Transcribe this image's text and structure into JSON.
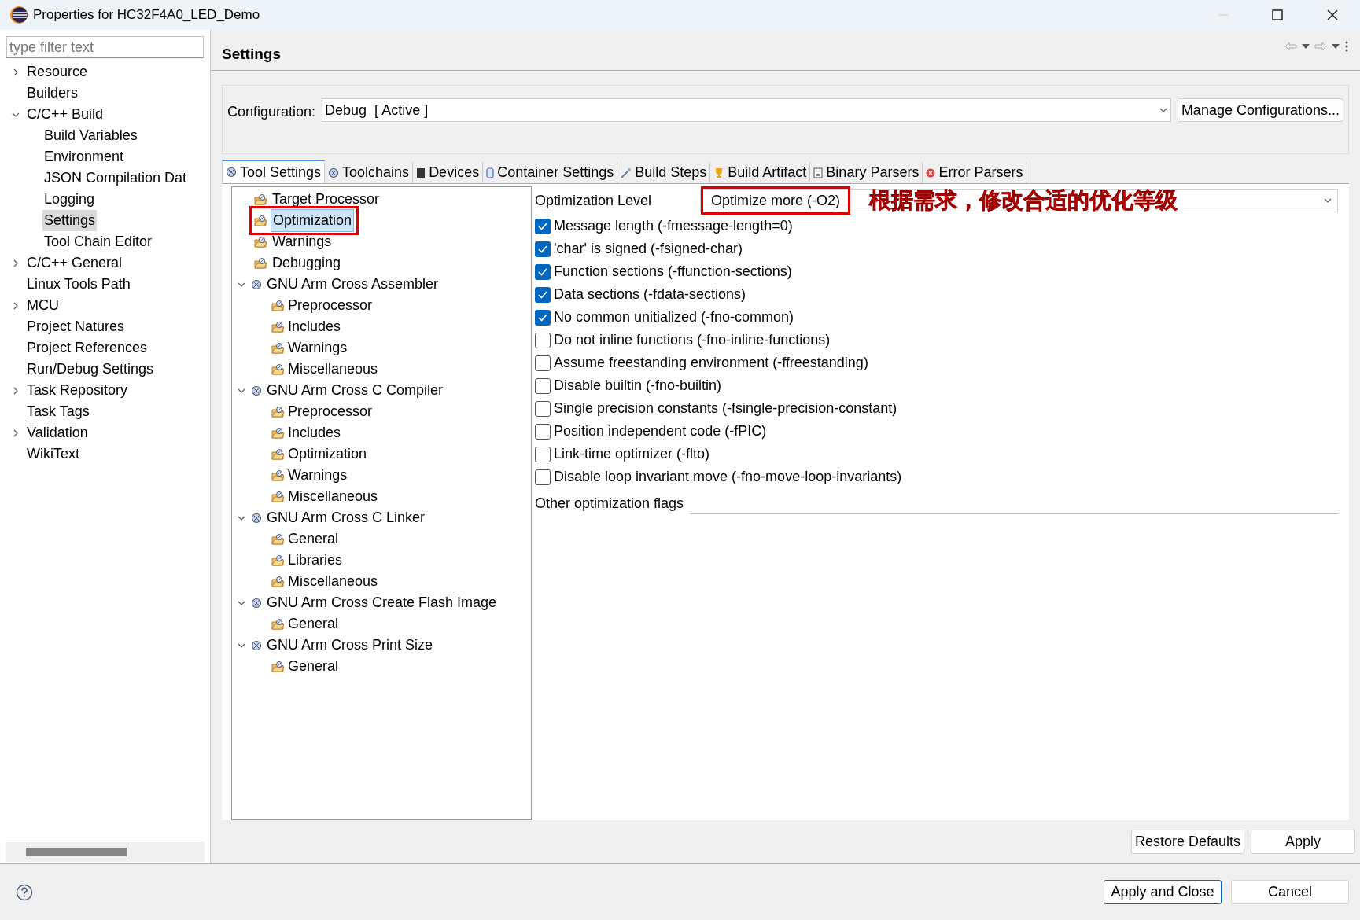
{
  "window": {
    "title": "Properties for HC32F4A0_LED_Demo"
  },
  "sidebar": {
    "filter": {
      "placeholder": "type filter text"
    },
    "items": [
      {
        "label": "Resource",
        "expanded": false,
        "selected": false
      },
      {
        "label": "Builders",
        "selected": false
      },
      {
        "label": "C/C++ Build",
        "expanded": true,
        "selected": false,
        "children": [
          {
            "label": "Build Variables",
            "selected": false
          },
          {
            "label": "Environment",
            "selected": false
          },
          {
            "label": "JSON Compilation Dat",
            "selected": false
          },
          {
            "label": "Logging",
            "selected": false
          },
          {
            "label": "Settings",
            "selected": true
          },
          {
            "label": "Tool Chain Editor",
            "selected": false
          }
        ]
      },
      {
        "label": "C/C++ General",
        "expanded": false,
        "selected": false
      },
      {
        "label": "Linux Tools Path",
        "selected": false
      },
      {
        "label": "MCU",
        "expanded": false,
        "selected": false
      },
      {
        "label": "Project Natures",
        "selected": false
      },
      {
        "label": "Project References",
        "selected": false
      },
      {
        "label": "Run/Debug Settings",
        "selected": false
      },
      {
        "label": "Task Repository",
        "expanded": false,
        "selected": false
      },
      {
        "label": "Task Tags",
        "selected": false
      },
      {
        "label": "Validation",
        "expanded": false,
        "selected": false
      },
      {
        "label": "WikiText",
        "selected": false
      }
    ]
  },
  "page": {
    "title": "Settings",
    "configuration": {
      "label": "Configuration:",
      "value": "Debug  [ Active ]",
      "button": "Manage Configurations..."
    },
    "tabs": [
      {
        "label": "Tool Settings",
        "selected": true
      },
      {
        "label": "Toolchains",
        "selected": false
      },
      {
        "label": "Devices",
        "selected": false
      },
      {
        "label": "Container Settings",
        "selected": false
      },
      {
        "label": "Build Steps",
        "selected": false
      },
      {
        "label": "Build Artifact",
        "selected": false
      },
      {
        "label": "Binary Parsers",
        "selected": false
      },
      {
        "label": "Error Parsers",
        "selected": false
      }
    ],
    "tool_tree": [
      {
        "label": "Target Processor",
        "selected": false,
        "highlighted": false
      },
      {
        "label": "Optimization",
        "selected": true,
        "highlighted": true
      },
      {
        "label": "Warnings",
        "selected": false,
        "highlighted": false
      },
      {
        "label": "Debugging",
        "selected": false,
        "highlighted": false
      },
      {
        "label": "GNU Arm Cross Assembler",
        "expanded": true,
        "children": [
          {
            "label": "Preprocessor",
            "selected": false
          },
          {
            "label": "Includes",
            "selected": false
          },
          {
            "label": "Warnings",
            "selected": false
          },
          {
            "label": "Miscellaneous",
            "selected": false
          }
        ]
      },
      {
        "label": "GNU Arm Cross C Compiler",
        "expanded": true,
        "children": [
          {
            "label": "Preprocessor",
            "selected": false
          },
          {
            "label": "Includes",
            "selected": false
          },
          {
            "label": "Optimization",
            "selected": false
          },
          {
            "label": "Warnings",
            "selected": false
          },
          {
            "label": "Miscellaneous",
            "selected": false
          }
        ]
      },
      {
        "label": "GNU Arm Cross C Linker",
        "expanded": true,
        "children": [
          {
            "label": "General",
            "selected": false
          },
          {
            "label": "Libraries",
            "selected": false
          },
          {
            "label": "Miscellaneous",
            "selected": false
          }
        ]
      },
      {
        "label": "GNU Arm Cross Create Flash Image",
        "expanded": true,
        "children": [
          {
            "label": "General",
            "selected": false
          }
        ]
      },
      {
        "label": "GNU Arm Cross Print Size",
        "expanded": true,
        "children": [
          {
            "label": "General",
            "selected": false
          }
        ]
      }
    ],
    "optimization_level": {
      "label": "Optimization Level",
      "value": "Optimize more (-O2)",
      "highlighted": true,
      "annotation": "根据需求，修改合适的优化等级"
    },
    "options": [
      {
        "label": "Message length (-fmessage-length=0)",
        "checked": true
      },
      {
        "label": "'char' is signed (-fsigned-char)",
        "checked": true
      },
      {
        "label": "Function sections (-ffunction-sections)",
        "checked": true
      },
      {
        "label": "Data sections (-fdata-sections)",
        "checked": true
      },
      {
        "label": "No common unitialized (-fno-common)",
        "checked": true
      },
      {
        "label": "Do not inline functions (-fno-inline-functions)",
        "checked": false
      },
      {
        "label": "Assume freestanding environment (-ffreestanding)",
        "checked": false
      },
      {
        "label": "Disable builtin (-fno-builtin)",
        "checked": false
      },
      {
        "label": "Single precision constants (-fsingle-precision-constant)",
        "checked": false
      },
      {
        "label": "Position independent code (-fPIC)",
        "checked": false
      },
      {
        "label": "Link-time optimizer (-flto)",
        "checked": false
      },
      {
        "label": "Disable loop invariant move (-fno-move-loop-invariants)",
        "checked": false
      }
    ],
    "other_flags": {
      "label": "Other optimization flags"
    },
    "buttons": [
      "Restore Defaults",
      "Apply"
    ]
  },
  "footer": {
    "buttons": [
      {
        "label": "Apply and Close",
        "default": true
      },
      {
        "label": "Cancel",
        "default": false
      }
    ]
  }
}
